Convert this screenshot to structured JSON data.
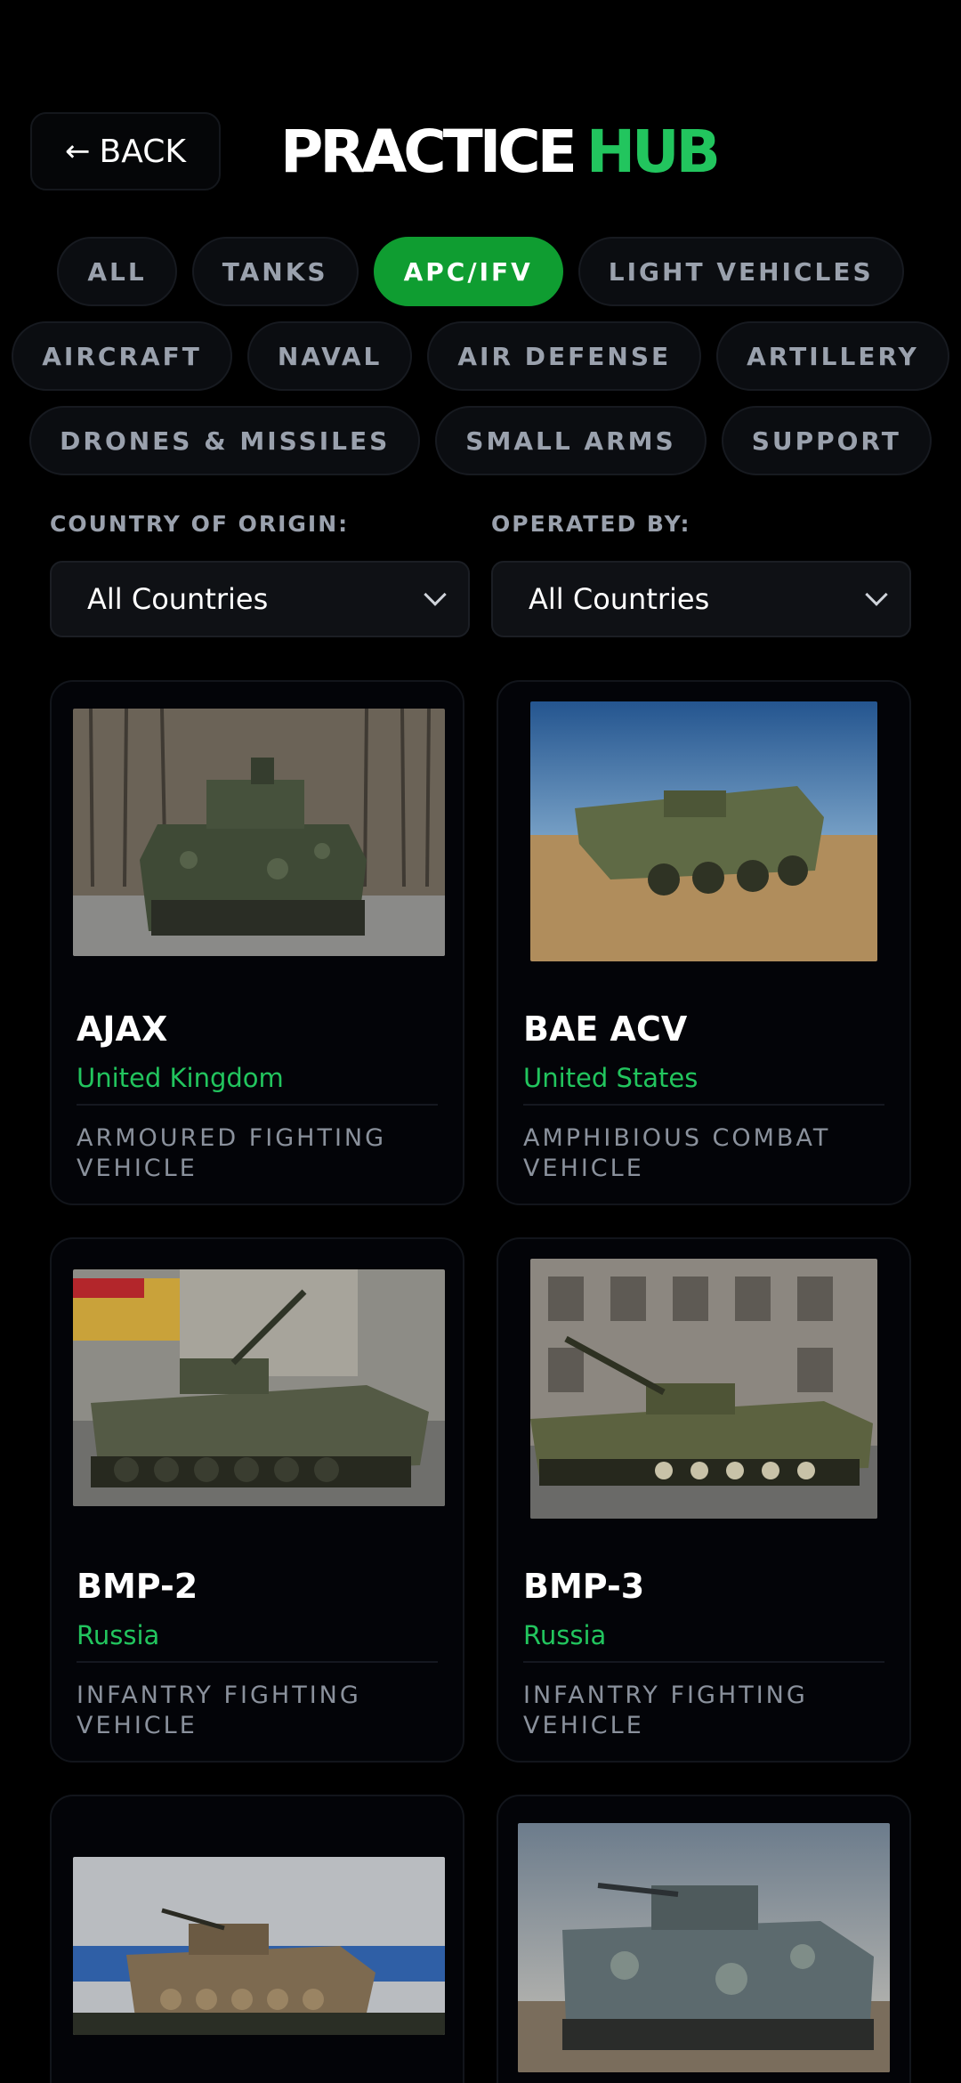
{
  "header": {
    "back_label": "BACK",
    "title_part1": "PRACTICE",
    "title_part2": "HUB"
  },
  "categories": [
    {
      "label": "ALL",
      "active": false
    },
    {
      "label": "TANKS",
      "active": false
    },
    {
      "label": "APC/IFV",
      "active": true
    },
    {
      "label": "LIGHT VEHICLES",
      "active": false
    },
    {
      "label": "AIRCRAFT",
      "active": false
    },
    {
      "label": "NAVAL",
      "active": false
    },
    {
      "label": "AIR DEFENSE",
      "active": false
    },
    {
      "label": "ARTILLERY",
      "active": false
    },
    {
      "label": "DRONES & MISSILES",
      "active": false
    },
    {
      "label": "SMALL ARMS",
      "active": false
    },
    {
      "label": "SUPPORT",
      "active": false
    }
  ],
  "filters": {
    "origin_label": "COUNTRY OF ORIGIN:",
    "origin_value": "All Countries",
    "operated_label": "OPERATED BY:",
    "operated_value": "All Countries"
  },
  "vehicles": [
    {
      "name": "AJAX",
      "country": "United Kingdom",
      "type": "ARMOURED FIGHTING VEHICLE",
      "icon": "tracked-ifv-photo"
    },
    {
      "name": "BAE ACV",
      "country": "United States",
      "type": "AMPHIBIOUS COMBAT VEHICLE",
      "icon": "wheeled-amphibious-photo"
    },
    {
      "name": "BMP-2",
      "country": "Russia",
      "type": "INFANTRY FIGHTING VEHICLE",
      "icon": "tracked-ifv-photo"
    },
    {
      "name": "BMP-3",
      "country": "Russia",
      "type": "INFANTRY FIGHTING VEHICLE",
      "icon": "tracked-ifv-photo"
    },
    {
      "name": "",
      "country": "",
      "type": "",
      "icon": "tracked-apc-photo"
    },
    {
      "name": "",
      "country": "",
      "type": "",
      "icon": "tracked-ifv-photo"
    }
  ],
  "colors": {
    "accent": "#22c55e",
    "active_chip": "#0f9d31",
    "background": "#000000"
  }
}
